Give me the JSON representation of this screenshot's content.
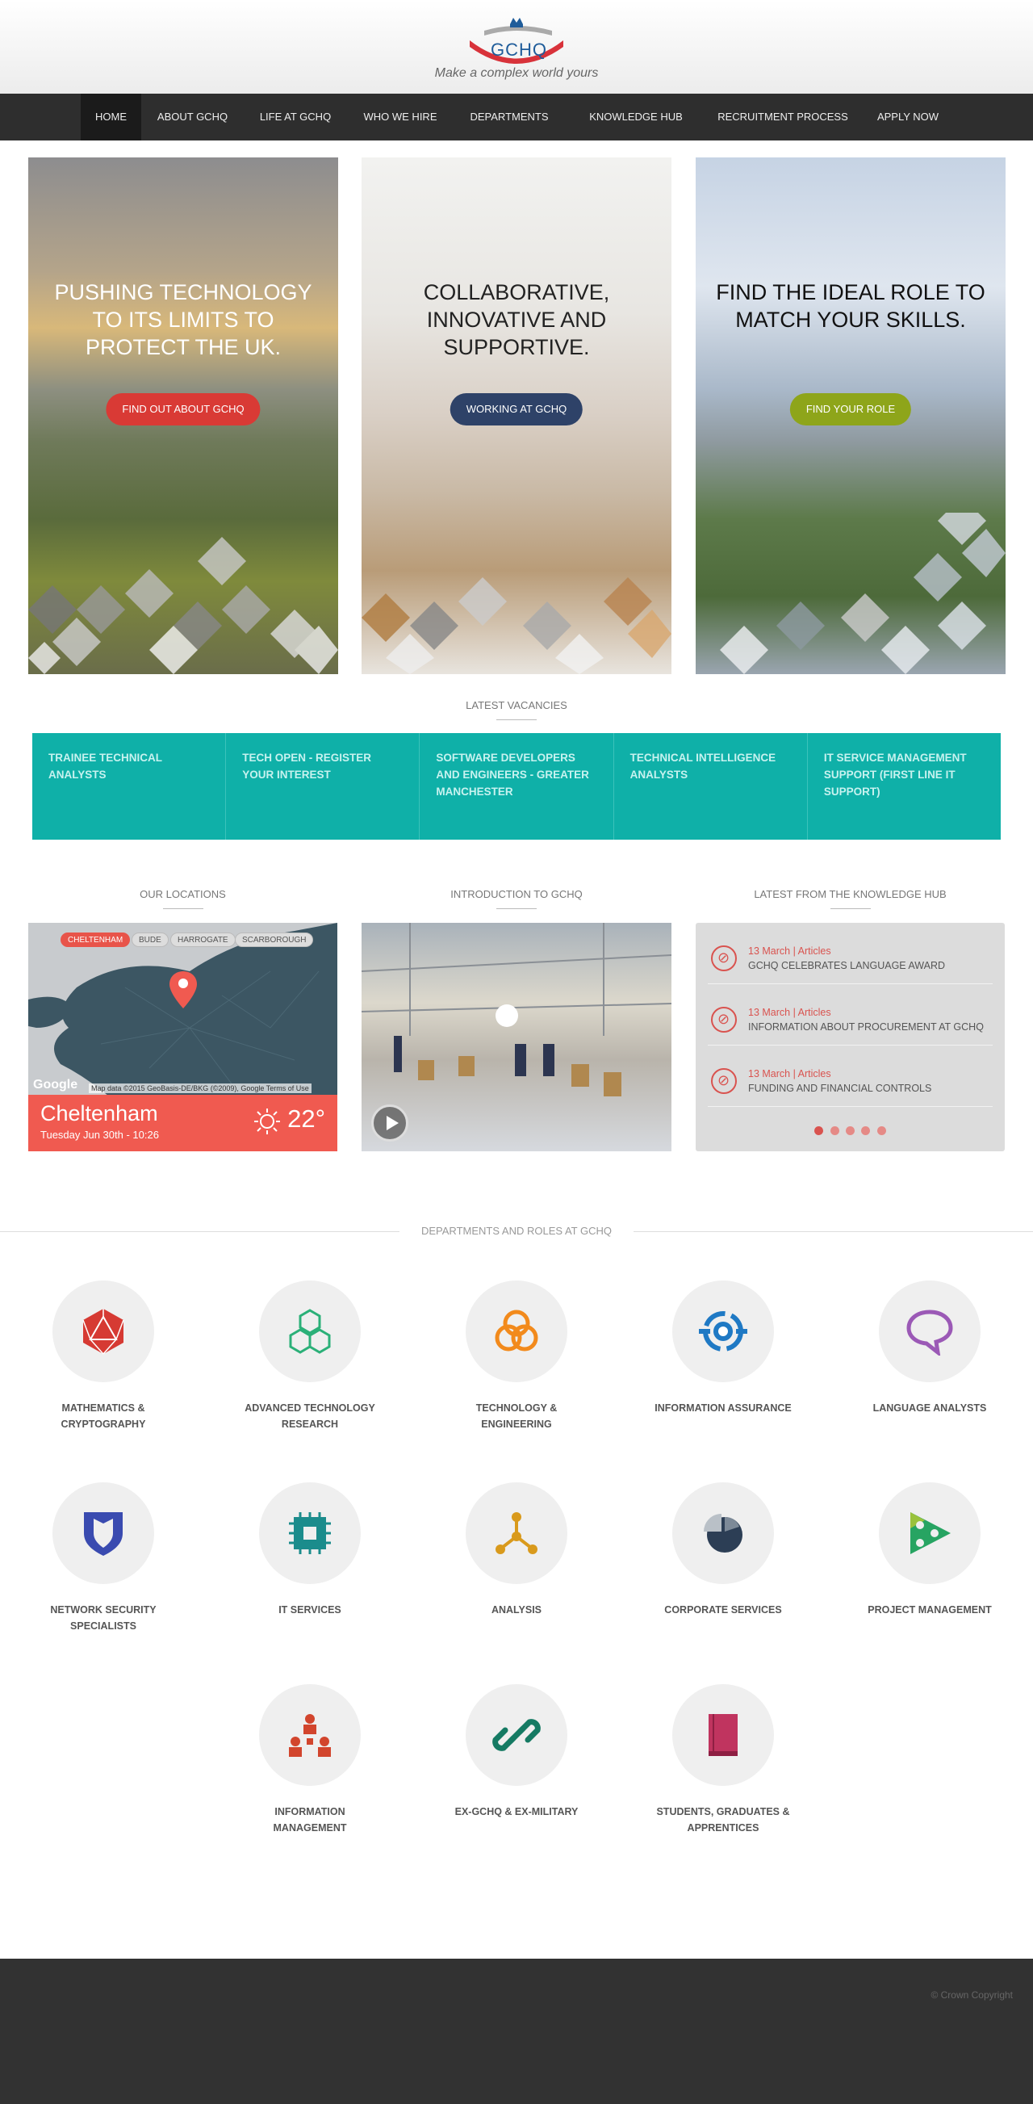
{
  "header": {
    "logo_text": "GCHQ",
    "tagline": "Make a complex world yours"
  },
  "nav": {
    "items": [
      {
        "label": "HOME"
      },
      {
        "label": "ABOUT GCHQ"
      },
      {
        "label": "LIFE AT GCHQ"
      },
      {
        "label": "WHO WE HIRE"
      },
      {
        "label": "DEPARTMENTS"
      },
      {
        "label": "KNOWLEDGE HUB"
      },
      {
        "label": "RECRUITMENT PROCESS"
      },
      {
        "label": "APPLY NOW"
      }
    ]
  },
  "hero": [
    {
      "title": "PUSHING TECHNOLOGY TO ITS LIMITS TO PROTECT THE UK.",
      "button": "FIND OUT ABOUT GCHQ",
      "button_color": "#d93a35"
    },
    {
      "title": "COLLABORATIVE, INNOVATIVE AND SUPPORTIVE.",
      "button": "WORKING AT GCHQ",
      "button_color": "#2e4268"
    },
    {
      "title": "FIND THE IDEAL ROLE TO MATCH YOUR SKILLS.",
      "button": "FIND YOUR ROLE",
      "button_color": "#8ea51a"
    }
  ],
  "vacancies": {
    "heading": "LATEST VACANCIES",
    "items": [
      "TRAINEE TECHNICAL ANALYSTS",
      "TECH OPEN - REGISTER YOUR INTEREST",
      "SOFTWARE DEVELOPERS AND ENGINEERS - GREATER MANCHESTER",
      "TECHNICAL INTELLIGENCE ANALYSTS",
      "IT SERVICE MANAGEMENT SUPPORT (FIRST LINE IT SUPPORT)"
    ]
  },
  "locations": {
    "heading": "OUR LOCATIONS",
    "tags": [
      "CHELTENHAM",
      "BUDE",
      "HARROGATE",
      "SCARBOROUGH"
    ],
    "city": "Cheltenham",
    "date": "Tuesday Jun 30th - 10:26",
    "temperature": "22°",
    "map_credit": "Map data ©2015 GeoBasis-DE/BKG (©2009), Google  Terms of Use",
    "google": "Google"
  },
  "intro": {
    "heading": "INTRODUCTION TO GCHQ"
  },
  "knowledge_hub": {
    "heading": "LATEST FROM THE KNOWLEDGE HUB",
    "items": [
      {
        "meta": "13 March | Articles",
        "title": "GCHQ CELEBRATES LANGUAGE AWARD"
      },
      {
        "meta": "13 March | Articles",
        "title": "INFORMATION ABOUT PROCUREMENT AT GCHQ"
      },
      {
        "meta": "13 March | Articles",
        "title": "FUNDING AND FINANCIAL CONTROLS"
      }
    ]
  },
  "departments": {
    "heading": "DEPARTMENTS AND ROLES AT GCHQ",
    "items": [
      {
        "label": "MATHEMATICS & CRYPTOGRAPHY",
        "icon": "icosahedron-icon",
        "color": "#d63a33"
      },
      {
        "label": "ADVANCED TECHNOLOGY RESEARCH",
        "icon": "cubes-icon",
        "color": "#2bb078"
      },
      {
        "label": "TECHNOLOGY & ENGINEERING",
        "icon": "rings-icon",
        "color": "#f28a1c"
      },
      {
        "label": "INFORMATION ASSURANCE",
        "icon": "target-icon",
        "color": "#1f79c4"
      },
      {
        "label": "LANGUAGE ANALYSTS",
        "icon": "speech-bubble-icon",
        "color": "#9b59b6"
      },
      {
        "label": "NETWORK SECURITY SPECIALISTS",
        "icon": "shield-icon",
        "color": "#3a4bb0"
      },
      {
        "label": "IT SERVICES",
        "icon": "chip-icon",
        "color": "#1b8c8c"
      },
      {
        "label": "ANALYSIS",
        "icon": "nodes-icon",
        "color": "#d99a1c"
      },
      {
        "label": "CORPORATE SERVICES",
        "icon": "pie-icon",
        "color": "#2c3e55"
      },
      {
        "label": "PROJECT MANAGEMENT",
        "icon": "triangle-icon",
        "color": "#27a462"
      },
      {
        "label": "INFORMATION MANAGEMENT",
        "icon": "org-chart-icon",
        "color": "#d2452d"
      },
      {
        "label": "EX-GCHQ & EX-MILITARY",
        "icon": "link-icon",
        "color": "#157a63"
      },
      {
        "label": "STUDENTS, GRADUATES & APPRENTICES",
        "icon": "book-icon",
        "color": "#c0345f"
      }
    ]
  },
  "footer": {
    "copyright": "© Crown Copyright"
  }
}
